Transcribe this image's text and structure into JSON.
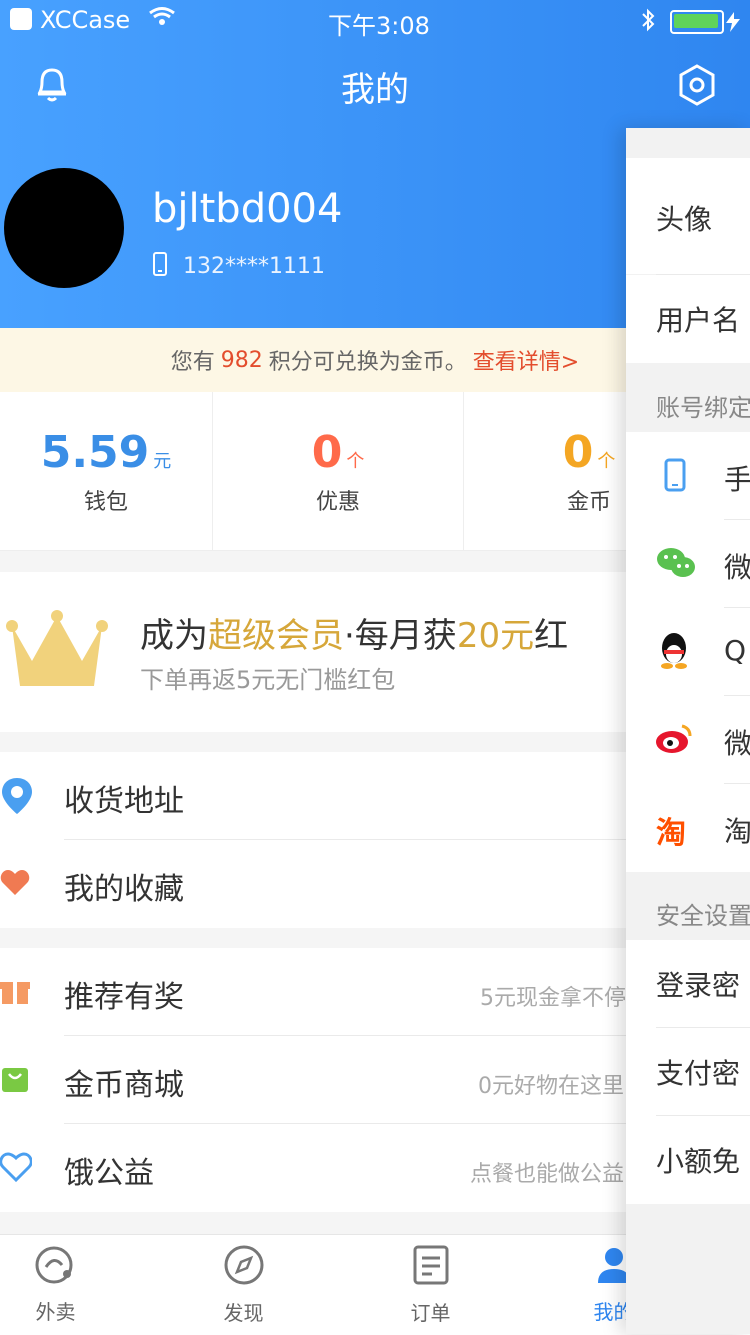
{
  "status": {
    "carrier": "XCCase",
    "time": "下午3:08"
  },
  "nav": {
    "title": "我的"
  },
  "user": {
    "name": "bjltbd004",
    "phone": "132****1111"
  },
  "points": {
    "prefix": "您有",
    "value": "982",
    "suffix": "积分可兑换为金币。",
    "link": "查看详情>"
  },
  "stats": [
    {
      "value": "5.59",
      "unit": "元",
      "label": "钱包",
      "color": "#3a8ee6"
    },
    {
      "value": "0",
      "unit": "个",
      "label": "优惠",
      "color": "#ff6a4a"
    },
    {
      "value": "0",
      "unit": "个",
      "label": "金币",
      "color": "#f4a623"
    }
  ],
  "promo": {
    "prefix": "成为",
    "highlight1": "超级会员",
    "middle": "·每月获",
    "highlight2": "20元",
    "suffix": "红",
    "subtitle": "下单再返5元无门槛红包"
  },
  "menu": {
    "group1": [
      {
        "title": "收货地址"
      },
      {
        "title": "我的收藏"
      }
    ],
    "group2": [
      {
        "title": "推荐有奖",
        "subtitle": "5元现金拿不停"
      },
      {
        "title": "金币商城",
        "subtitle": "0元好物在这里"
      },
      {
        "title": "饿公益",
        "subtitle": "点餐也能做公益"
      }
    ]
  },
  "tabs": [
    {
      "label": "外卖"
    },
    {
      "label": "发现"
    },
    {
      "label": "订单"
    },
    {
      "label": "我的"
    }
  ],
  "panel": {
    "items_top": [
      "头像",
      "用户名"
    ],
    "section_bind": "账号绑定",
    "bind_items": [
      "手",
      "微",
      "Q",
      "微",
      "淘"
    ],
    "section_security": "安全设置",
    "security_items": [
      "登录密",
      "支付密",
      "小额免"
    ]
  }
}
